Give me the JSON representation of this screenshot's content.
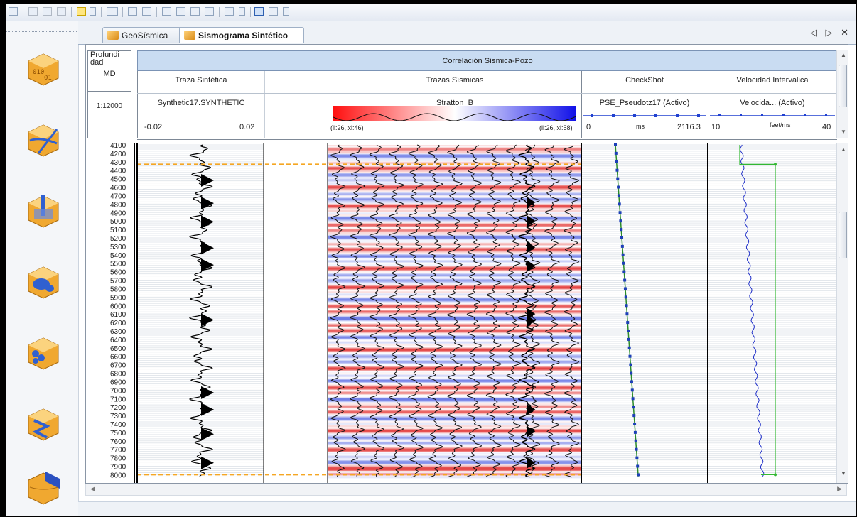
{
  "tabs": [
    {
      "label": "GeoSísmica"
    },
    {
      "label": "Sismograma Sintético"
    }
  ],
  "tab_controls": "◁ ▷ ✕",
  "toolbar": {
    "glyphs": "▪ ✂ ⎘ ⎗ ? ▾"
  },
  "header": {
    "depth_title": "Profundidad",
    "depth_title_line1": "Profundi",
    "depth_title_line2": "dad",
    "depth_ref": "MD",
    "scale": "1:12000",
    "group_title": "Correlación Sísmica-Pozo",
    "synthetic": {
      "title": "Traza Sintética",
      "name": "Synthetic17.SYNTHETIC",
      "min": "-0.02",
      "max": "0.02"
    },
    "seismic": {
      "title": "Trazas Sísmicas",
      "name": "Stratton_B",
      "left_label": "(il:26, xl:46)",
      "right_label": "(il:26, xl:58)"
    },
    "checkshot": {
      "title": "CheckShot",
      "name": "PSE_Pseudotz17 (Activo)",
      "min": "0",
      "unit": "ms",
      "max": "2116.3"
    },
    "velocity": {
      "title": "Velocidad Interválica",
      "name": "Velocida... (Activo)",
      "min": "10",
      "unit": "feet/ms",
      "max": "40"
    }
  },
  "depth_labels": [
    "4100",
    "4200",
    "4300",
    "4400",
    "4500",
    "4600",
    "4700",
    "4800",
    "4900",
    "5000",
    "5100",
    "5200",
    "5300",
    "5400",
    "5500",
    "5600",
    "5700",
    "5800",
    "5900",
    "6000",
    "6100",
    "6200",
    "6300",
    "6400",
    "6500",
    "6600",
    "6700",
    "6800",
    "6900",
    "7000",
    "7100",
    "7200",
    "7300",
    "7400",
    "7500",
    "7600",
    "7700",
    "7800",
    "7900",
    "8000"
  ],
  "markers": {
    "top_depth": 4330,
    "bottom_depth": 8000
  },
  "colors": {
    "marker": "#f5a623",
    "checkshot": "#2a8a2a",
    "velocity": "#2030c8",
    "seismic_pos": "#e03030",
    "seismic_neg": "#3050e0"
  }
}
